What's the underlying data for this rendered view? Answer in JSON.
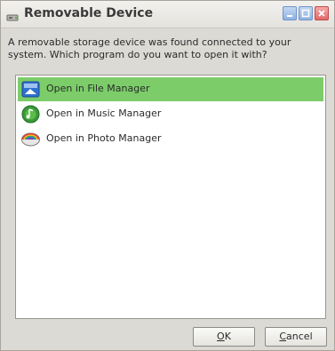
{
  "window": {
    "title": "Removable Device",
    "title_icon": "drive-icon",
    "controls": [
      "minimize-icon",
      "maximize-icon",
      "close-icon"
    ]
  },
  "message": "A removable storage device was found connected to your system. Which program do you want to open it with?",
  "list": {
    "items": [
      {
        "label": "Open in File Manager",
        "icon": "file-manager-icon",
        "selected": true
      },
      {
        "label": "Open in Music Manager",
        "icon": "music-manager-icon",
        "selected": false
      },
      {
        "label": "Open in Photo Manager",
        "icon": "photo-manager-icon",
        "selected": false
      }
    ]
  },
  "buttons": {
    "ok": {
      "mnemonic": "O",
      "rest": "K"
    },
    "cancel": {
      "mnemonic": "C",
      "rest": "ancel"
    }
  },
  "colors": {
    "selection": "#7ccd6a",
    "window_bg": "#dcdad5"
  }
}
